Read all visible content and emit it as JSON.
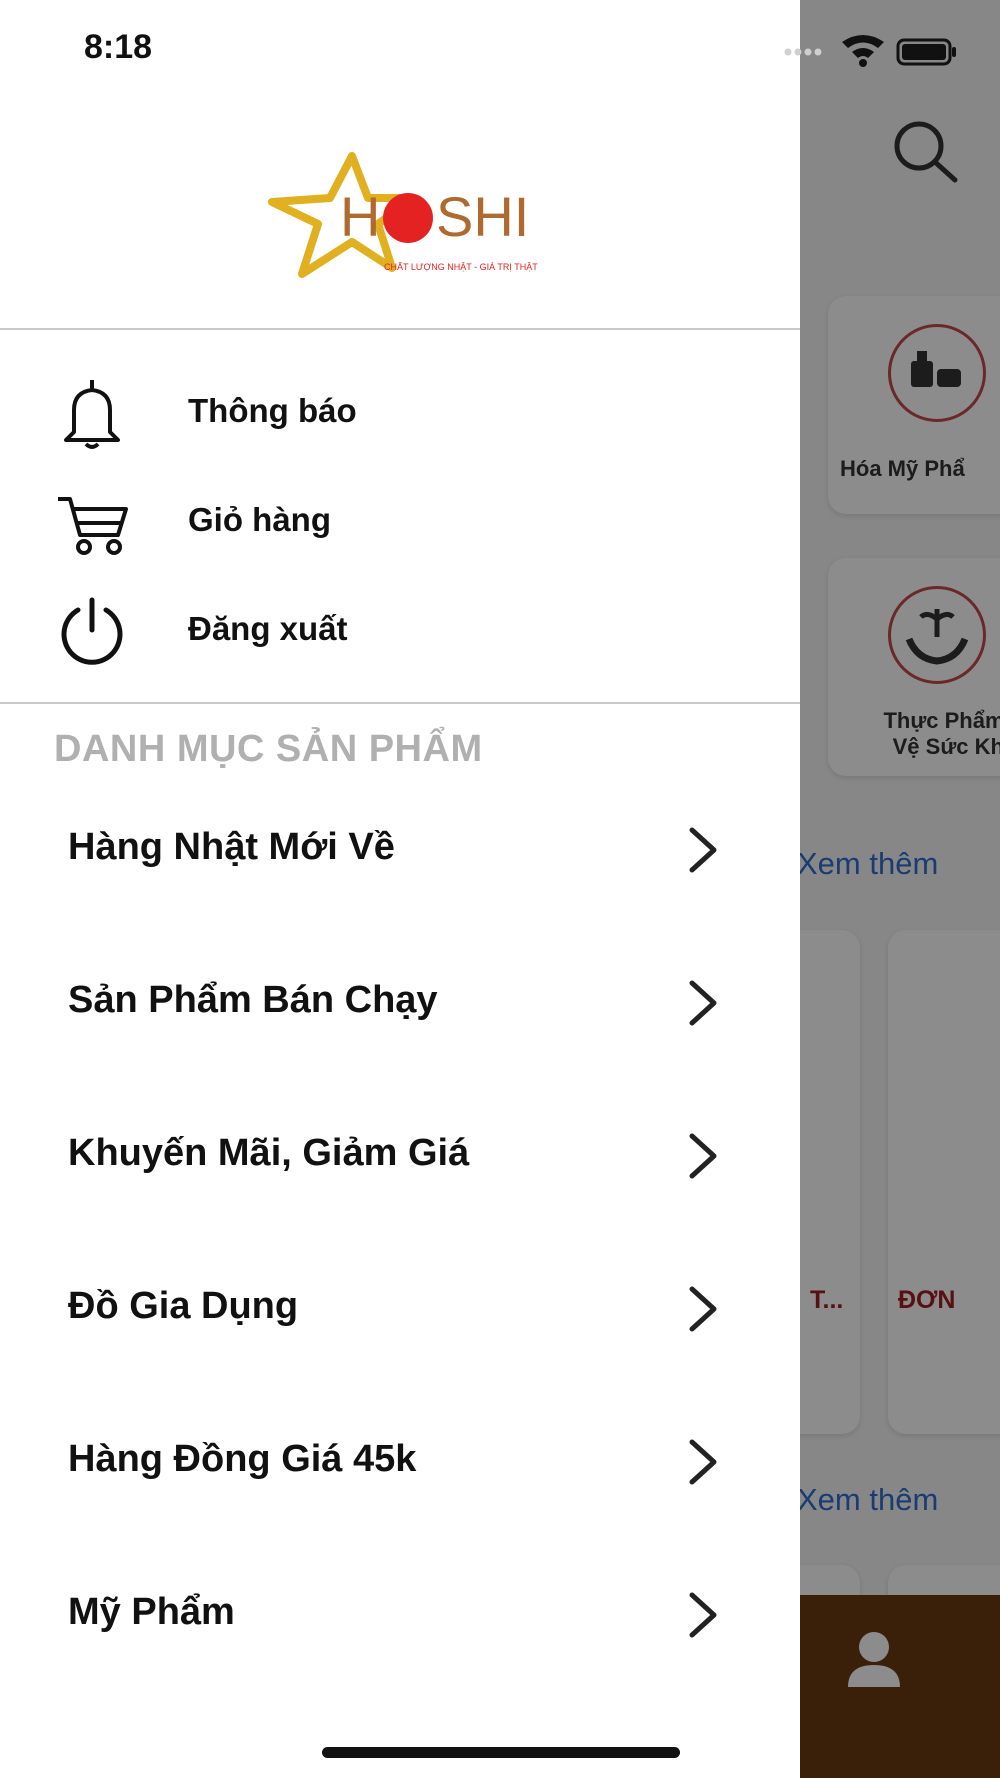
{
  "status_bar": {
    "time": "8:18"
  },
  "drawer": {
    "logo": {
      "brand": "HOSHI",
      "tagline": "CHẤT LƯỢNG NHẬT - GIÁ TRỊ THẬT"
    },
    "menu": [
      {
        "label": "Thông báo",
        "icon": "bell-icon"
      },
      {
        "label": "Giỏ hàng",
        "icon": "cart-icon"
      },
      {
        "label": "Đăng xuất",
        "icon": "power-icon"
      }
    ],
    "section_title": "DANH MỤC SẢN PHẨM",
    "categories": [
      {
        "label": "Hàng Nhật Mới Về"
      },
      {
        "label": "Sản Phẩm Bán Chạy"
      },
      {
        "label": "Khuyến Mãi, Giảm Giá"
      },
      {
        "label": "Đồ Gia Dụng"
      },
      {
        "label": "Hàng Đồng Giá 45k"
      },
      {
        "label": "Mỹ Phẩm"
      }
    ]
  },
  "background": {
    "category_cards": [
      {
        "label": "Hóa Mỹ Phẩ"
      },
      {
        "label": "Thực Phẩm B\nVệ Sức Khỏ"
      }
    ],
    "see_more_1": "Xem thêm",
    "see_more_2": "Xem thêm",
    "product_title_a": "T...",
    "product_title_b": "ĐƠN"
  },
  "colors": {
    "overlay": "#000000",
    "link_blue": "#2f6fd0",
    "brand_brown": "#6b3b12",
    "logo_star": "#e0b020",
    "logo_red": "#e52222",
    "logo_text": "#b06a30"
  }
}
